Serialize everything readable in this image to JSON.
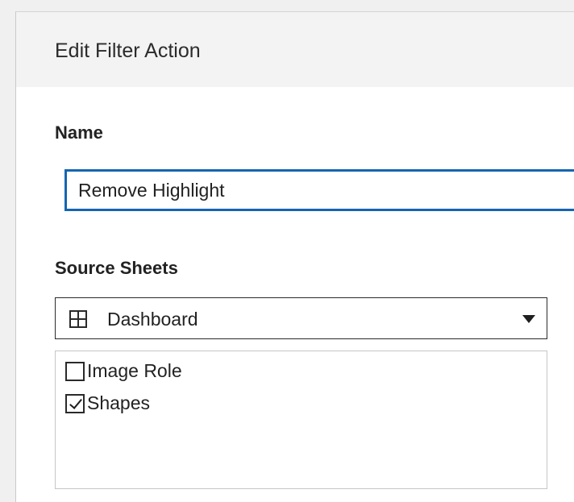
{
  "dialog": {
    "title": "Edit Filter Action"
  },
  "name_section": {
    "label": "Name",
    "input_value": "Remove Highlight"
  },
  "source_sheets": {
    "label": "Source Sheets",
    "dropdown": {
      "icon": "dashboard-grid-icon",
      "selected": "Dashboard",
      "arrow_icon": "chevron-down-icon"
    },
    "items": [
      {
        "label": "Image Role",
        "checked": false
      },
      {
        "label": "Shapes",
        "checked": true
      }
    ]
  }
}
